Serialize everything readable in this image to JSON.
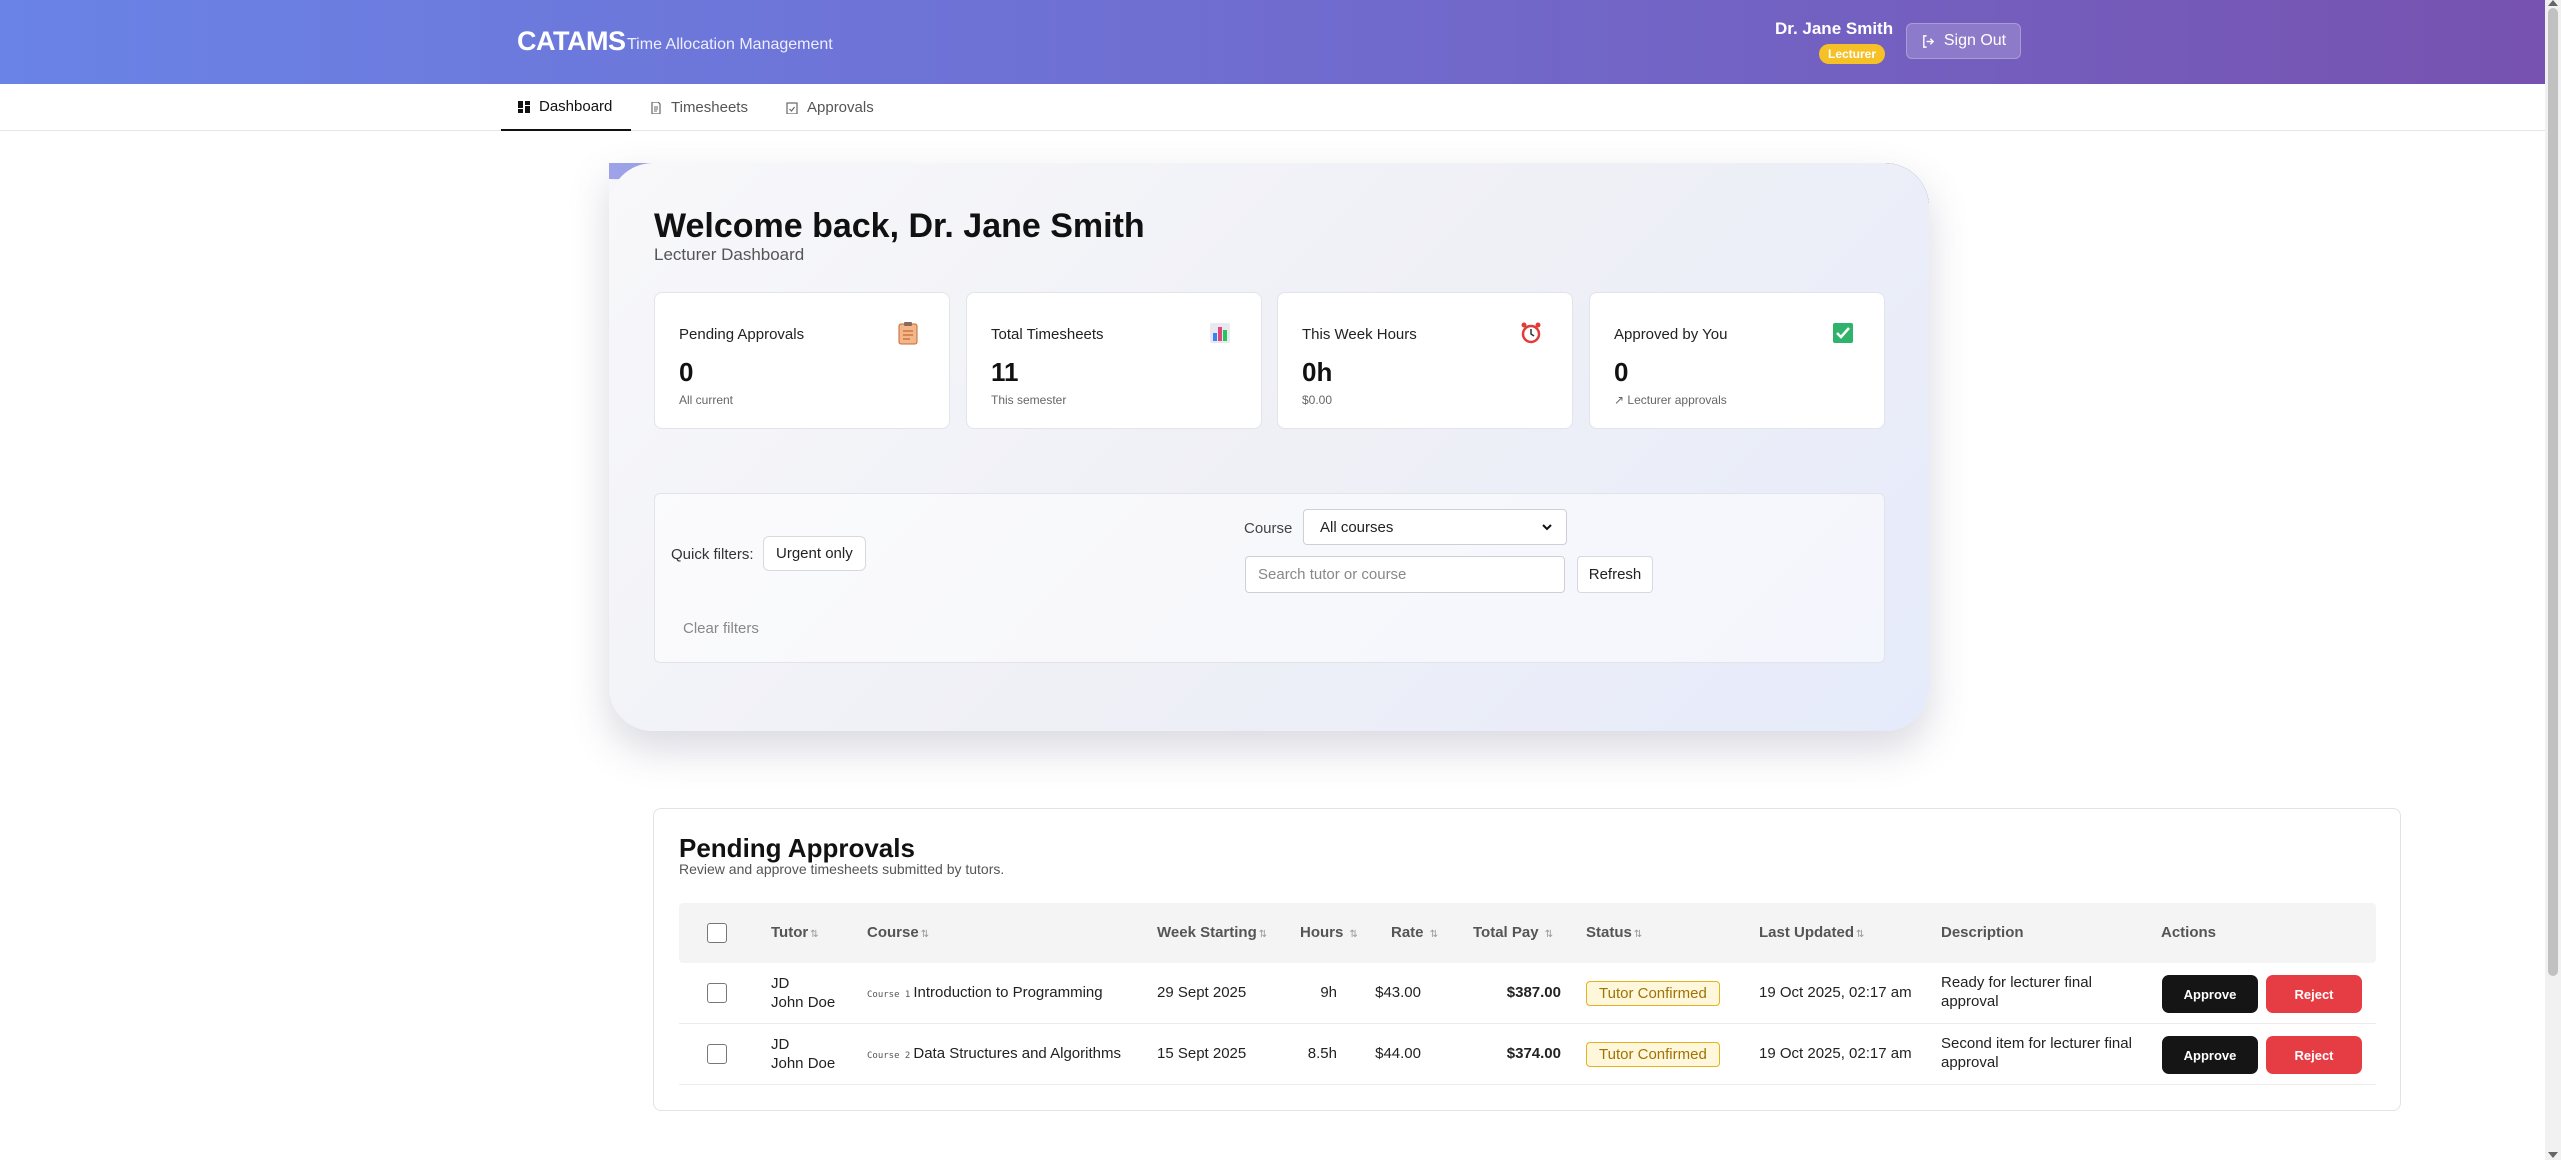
{
  "header": {
    "brand": "CATAMS",
    "subtitle": "Time Allocation Management",
    "user_name": "Dr. Jane Smith",
    "role": "Lecturer",
    "sign_out": "Sign Out"
  },
  "nav": {
    "tabs": [
      {
        "label": "Dashboard",
        "active": true
      },
      {
        "label": "Timesheets",
        "active": false
      },
      {
        "label": "Approvals",
        "active": false
      }
    ]
  },
  "welcome": {
    "title": "Welcome back, Dr. Jane Smith",
    "subtitle": "Lecturer Dashboard"
  },
  "stats": [
    {
      "label": "Pending Approvals",
      "value": "0",
      "hint": "All current",
      "icon": "clipboard-icon"
    },
    {
      "label": "Total Timesheets",
      "value": "11",
      "hint": "This semester",
      "icon": "bar-chart-icon"
    },
    {
      "label": "This Week Hours",
      "value": "0h",
      "hint": "$0.00",
      "icon": "alarm-clock-icon"
    },
    {
      "label": "Approved by You",
      "value": "0",
      "hint": "↗ Lecturer approvals",
      "icon": "check-box-icon"
    }
  ],
  "filters": {
    "quick_label": "Quick filters:",
    "urgent_only": "Urgent only",
    "course_label": "Course",
    "course_selected": "All courses",
    "search_placeholder": "Search tutor or course",
    "refresh": "Refresh",
    "clear": "Clear filters"
  },
  "pending": {
    "title": "Pending Approvals",
    "subtitle": "Review and approve timesheets submitted by tutors.",
    "columns": {
      "tutor": "Tutor",
      "course": "Course",
      "week": "Week Starting",
      "hours": "Hours",
      "rate": "Rate",
      "pay": "Total Pay",
      "status": "Status",
      "updated": "Last Updated",
      "description": "Description",
      "actions": "Actions"
    },
    "sort_glyph": "⇅",
    "approve_label": "Approve",
    "reject_label": "Reject",
    "rows": [
      {
        "initials": "JD",
        "name": "John Doe",
        "course_code": "Course 1",
        "course_name": "Introduction to Programming",
        "week": "29 Sept 2025",
        "hours": "9h",
        "rate": "$43.00",
        "pay": "$387.00",
        "status": "Tutor Confirmed",
        "updated": "19 Oct 2025, 02:17 am",
        "description": "Ready for lecturer final approval"
      },
      {
        "initials": "JD",
        "name": "John Doe",
        "course_code": "Course 2",
        "course_name": "Data Structures and Algorithms",
        "week": "15 Sept 2025",
        "hours": "8.5h",
        "rate": "$44.00",
        "pay": "$374.00",
        "status": "Tutor Confirmed",
        "updated": "19 Oct 2025, 02:17 am",
        "description": "Second item for lecturer final approval"
      }
    ]
  },
  "colors": {
    "header_start": "#6a83e6",
    "header_end": "#7752b0",
    "role_badge": "#f6c027",
    "approve": "#151515",
    "reject": "#e63d44",
    "status_border": "#e3b21c"
  }
}
